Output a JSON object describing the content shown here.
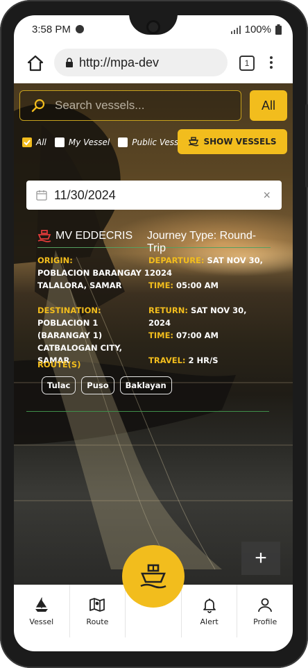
{
  "status_bar": {
    "time": "3:58 PM",
    "battery": "100%"
  },
  "browser": {
    "url": "http://mpa-dev",
    "tab_count": "1"
  },
  "search": {
    "placeholder": "Search vessels...",
    "filter_button": "All"
  },
  "filters": [
    {
      "label": "All",
      "checked": true
    },
    {
      "label": "My Vessel",
      "checked": false
    },
    {
      "label": "Public Vessel",
      "checked": false
    }
  ],
  "show_vessels_label": "SHOW VESSELS",
  "date": {
    "value": "11/30/2024",
    "clear": "×"
  },
  "vessel_card": {
    "name": "MV EDDECRIS",
    "journey": "Journey Type: Round-Trip",
    "origin_label": "ORIGIN:",
    "origin": [
      "POBLACION BARANGAY 12024",
      "TALALORA, SAMAR"
    ],
    "departure_label": "DEPARTURE:",
    "departure": "SAT NOV 30,",
    "departure_time_label": "TIME:",
    "departure_time": "05:00 AM",
    "destination_label": "DESTINATION:",
    "destination": [
      "POBLACION 1",
      "(BARANGAY 1)",
      "CATBALOGAN CITY,",
      "SAMAR"
    ],
    "return_label": "RETURN:",
    "return": "SAT NOV 30, 2024",
    "return_time_label": "TIME:",
    "return_time": "07:00 AM",
    "travel_label": "TRAVEL:",
    "travel": "2 HR/S",
    "routes_label": "ROUTE(S)",
    "routes": [
      "Tulac",
      "Puso",
      "Baklayan"
    ]
  },
  "fab_plus": "+",
  "nav": [
    {
      "label": "Vessel",
      "icon": "sailboat-icon"
    },
    {
      "label": "Route",
      "icon": "map-icon"
    },
    {
      "label": "",
      "icon": "ship-icon"
    },
    {
      "label": "Alert",
      "icon": "bell-icon"
    },
    {
      "label": "Profile",
      "icon": "user-icon"
    }
  ],
  "colors": {
    "accent": "#f2bd1d",
    "vessel_red": "#e03a3a",
    "divider_green": "#55a060"
  }
}
